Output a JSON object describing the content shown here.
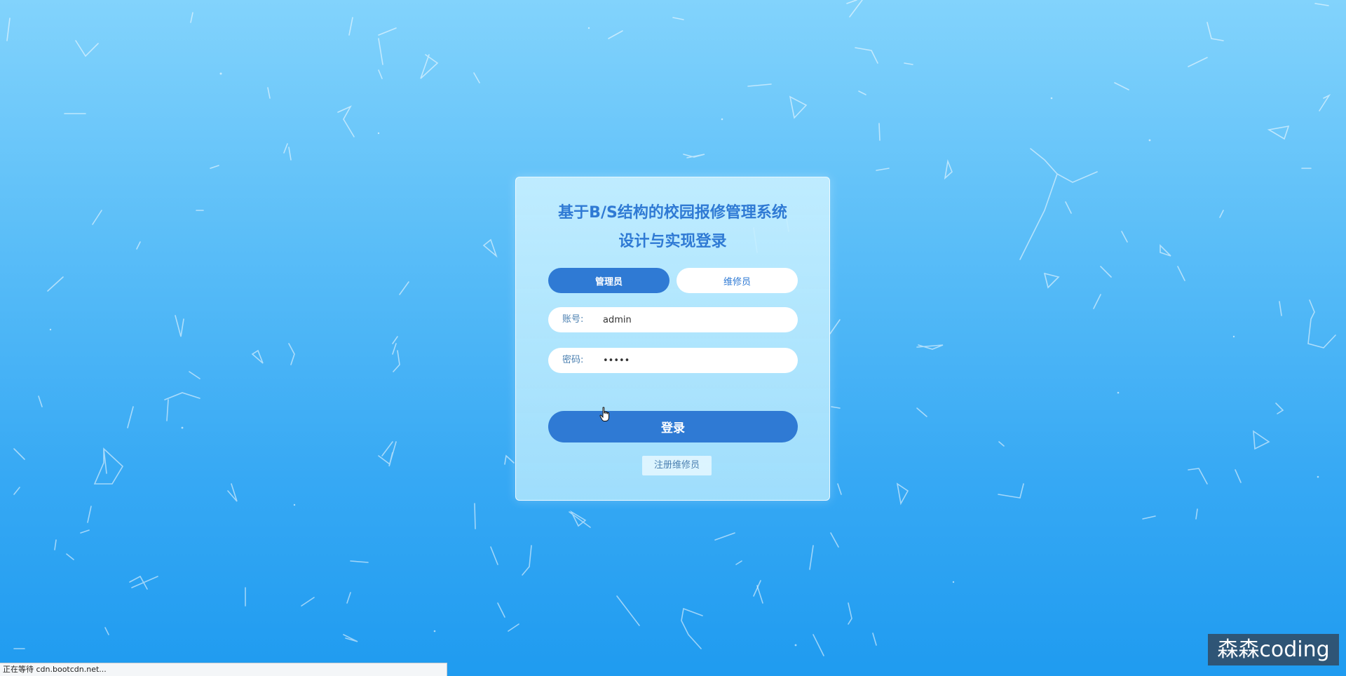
{
  "login": {
    "title_line1": "基于B/S结构的校园报修管理系统",
    "title_line2": "设计与实现登录",
    "roles": {
      "admin": "管理员",
      "repairer": "维修员"
    },
    "selected_role": "管理员",
    "account": {
      "label": "账号:",
      "value": "admin"
    },
    "password": {
      "label": "密码:",
      "value": "•••••"
    },
    "login_button": "登录",
    "register_link": "注册维修员"
  },
  "status_bar": {
    "text": "正在等待 cdn.bootcdn.net..."
  },
  "watermark": {
    "text": "森森coding"
  },
  "colors": {
    "accent": "#2f7ad4",
    "background_top": "#82d3fc",
    "background_bottom": "#1f9bf0",
    "card_background": "#c8f0ff"
  },
  "icons": {
    "cursor": "hand-pointer-icon",
    "background": "particle-network"
  }
}
